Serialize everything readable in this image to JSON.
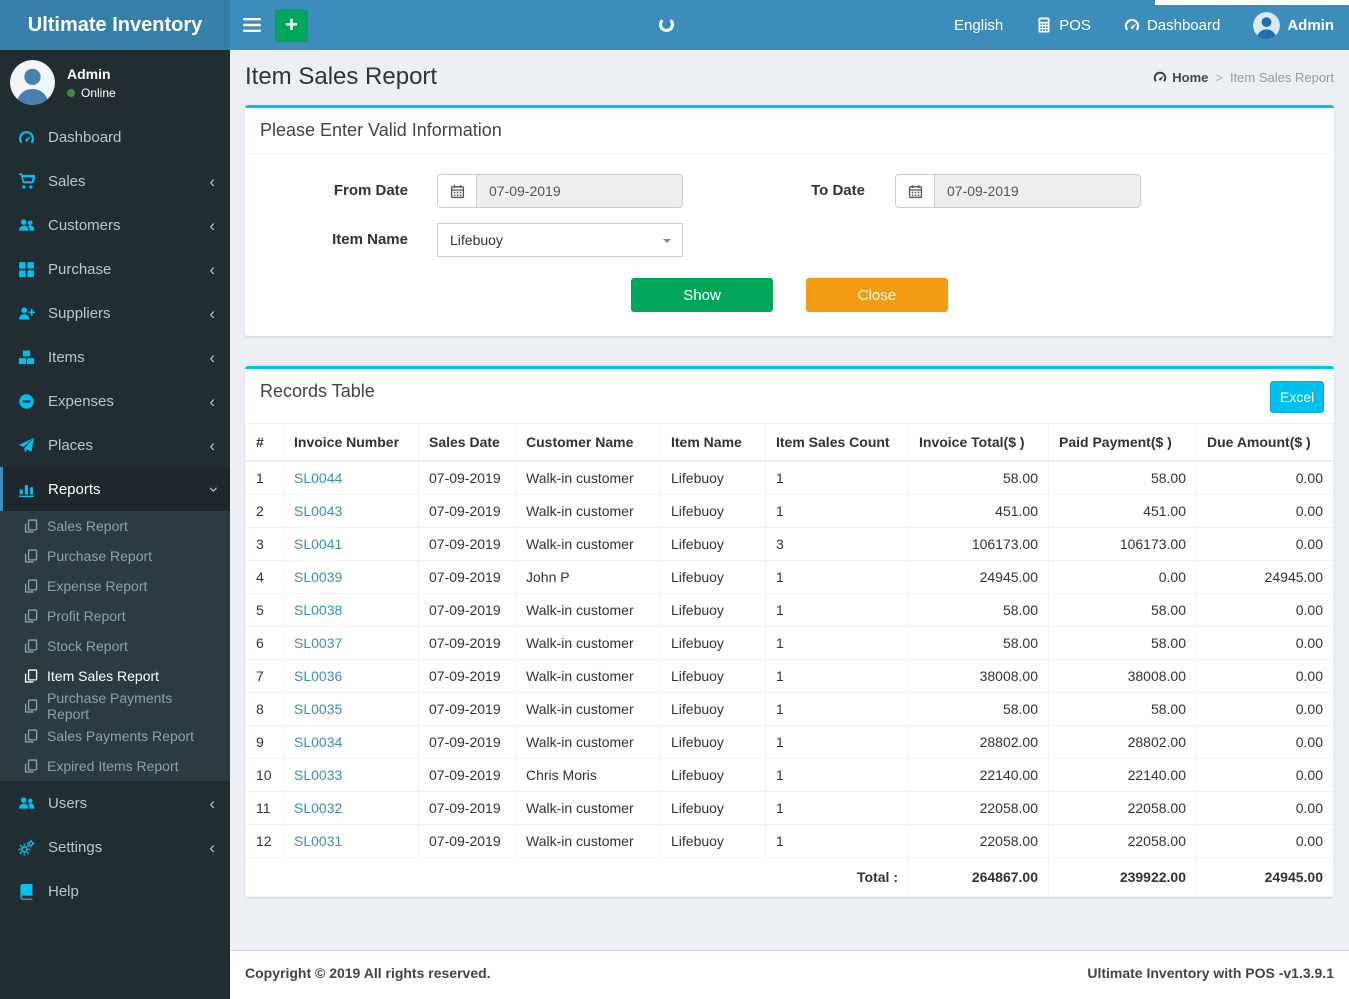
{
  "app": {
    "logo": "Ultimate Inventory"
  },
  "navbar": {
    "language": "English",
    "pos": "POS",
    "dashboard": "Dashboard",
    "user": "Admin"
  },
  "sidebar": {
    "user": {
      "name": "Admin",
      "status": "Online"
    },
    "menu": [
      {
        "label": "Dashboard",
        "icon": "dashboard-icon"
      },
      {
        "label": "Sales",
        "icon": "cart-icon",
        "chevron": "left"
      },
      {
        "label": "Customers",
        "icon": "users-icon",
        "chevron": "left"
      },
      {
        "label": "Purchase",
        "icon": "grid-icon",
        "chevron": "left"
      },
      {
        "label": "Suppliers",
        "icon": "user-plus-icon",
        "chevron": "left"
      },
      {
        "label": "Items",
        "icon": "cubes-icon",
        "chevron": "left"
      },
      {
        "label": "Expenses",
        "icon": "minus-circle-icon",
        "chevron": "left"
      },
      {
        "label": "Places",
        "icon": "paper-plane-icon",
        "chevron": "left"
      },
      {
        "label": "Reports",
        "icon": "bar-chart-icon",
        "chevron": "down",
        "active": true,
        "submenu": [
          {
            "label": "Sales Report"
          },
          {
            "label": "Purchase Report"
          },
          {
            "label": "Expense Report"
          },
          {
            "label": "Profit Report"
          },
          {
            "label": "Stock Report"
          },
          {
            "label": "Item Sales Report",
            "active": true
          },
          {
            "label": "Purchase Payments Report"
          },
          {
            "label": "Sales Payments Report"
          },
          {
            "label": "Expired Items Report"
          }
        ]
      },
      {
        "label": "Users",
        "icon": "users-icon",
        "chevron": "left"
      },
      {
        "label": "Settings",
        "icon": "gears-icon",
        "chevron": "left"
      },
      {
        "label": "Help",
        "icon": "book-icon"
      }
    ]
  },
  "page": {
    "title": "Item Sales Report",
    "breadcrumb": {
      "home": "Home",
      "current": "Item Sales Report"
    }
  },
  "filter": {
    "title": "Please Enter Valid Information",
    "from_label": "From Date",
    "from_value": "07-09-2019",
    "to_label": "To Date",
    "to_value": "07-09-2019",
    "item_label": "Item Name",
    "item_value": "Lifebuoy",
    "show_label": "Show",
    "close_label": "Close"
  },
  "records": {
    "title": "Records Table",
    "excel_label": "Excel",
    "headers": [
      "#",
      "Invoice Number",
      "Sales Date",
      "Customer Name",
      "Item Name",
      "Item Sales Count",
      "Invoice Total($ )",
      "Paid Payment($ )",
      "Due Amount($ )"
    ],
    "rows": [
      [
        "1",
        "SL0044",
        "07-09-2019",
        "Walk-in customer",
        "Lifebuoy",
        "1",
        "58.00",
        "58.00",
        "0.00"
      ],
      [
        "2",
        "SL0043",
        "07-09-2019",
        "Walk-in customer",
        "Lifebuoy",
        "1",
        "451.00",
        "451.00",
        "0.00"
      ],
      [
        "3",
        "SL0041",
        "07-09-2019",
        "Walk-in customer",
        "Lifebuoy",
        "3",
        "106173.00",
        "106173.00",
        "0.00"
      ],
      [
        "4",
        "SL0039",
        "07-09-2019",
        "John P",
        "Lifebuoy",
        "1",
        "24945.00",
        "0.00",
        "24945.00"
      ],
      [
        "5",
        "SL0038",
        "07-09-2019",
        "Walk-in customer",
        "Lifebuoy",
        "1",
        "58.00",
        "58.00",
        "0.00"
      ],
      [
        "6",
        "SL0037",
        "07-09-2019",
        "Walk-in customer",
        "Lifebuoy",
        "1",
        "58.00",
        "58.00",
        "0.00"
      ],
      [
        "7",
        "SL0036",
        "07-09-2019",
        "Walk-in customer",
        "Lifebuoy",
        "1",
        "38008.00",
        "38008.00",
        "0.00"
      ],
      [
        "8",
        "SL0035",
        "07-09-2019",
        "Walk-in customer",
        "Lifebuoy",
        "1",
        "58.00",
        "58.00",
        "0.00"
      ],
      [
        "9",
        "SL0034",
        "07-09-2019",
        "Walk-in customer",
        "Lifebuoy",
        "1",
        "28802.00",
        "28802.00",
        "0.00"
      ],
      [
        "10",
        "SL0033",
        "07-09-2019",
        "Chris Moris",
        "Lifebuoy",
        "1",
        "22140.00",
        "22140.00",
        "0.00"
      ],
      [
        "11",
        "SL0032",
        "07-09-2019",
        "Walk-in customer",
        "Lifebuoy",
        "1",
        "22058.00",
        "22058.00",
        "0.00"
      ],
      [
        "12",
        "SL0031",
        "07-09-2019",
        "Walk-in customer",
        "Lifebuoy",
        "1",
        "22058.00",
        "22058.00",
        "0.00"
      ]
    ],
    "total_label": "Total :",
    "total_invoice": "264867.00",
    "total_paid": "239922.00",
    "total_due": "24945.00"
  },
  "footer": {
    "copyright": "Copyright © 2019 All rights reserved.",
    "version": "Ultimate Inventory with POS -v1.3.9.1"
  },
  "colors": {
    "navbar": "#3c8dbc",
    "logo_bg": "#367fa9",
    "sidebar_bg": "#222d32",
    "submenu_bg": "#2c3b41",
    "icon_accent": "#00c0ef",
    "panel_top_border": "#00c0ef",
    "show_button": "#00a65a",
    "close_button": "#f39c12",
    "excel_button": "#00c0ef",
    "link": "#3c8dbc",
    "online_dot": "#3d8b40"
  }
}
